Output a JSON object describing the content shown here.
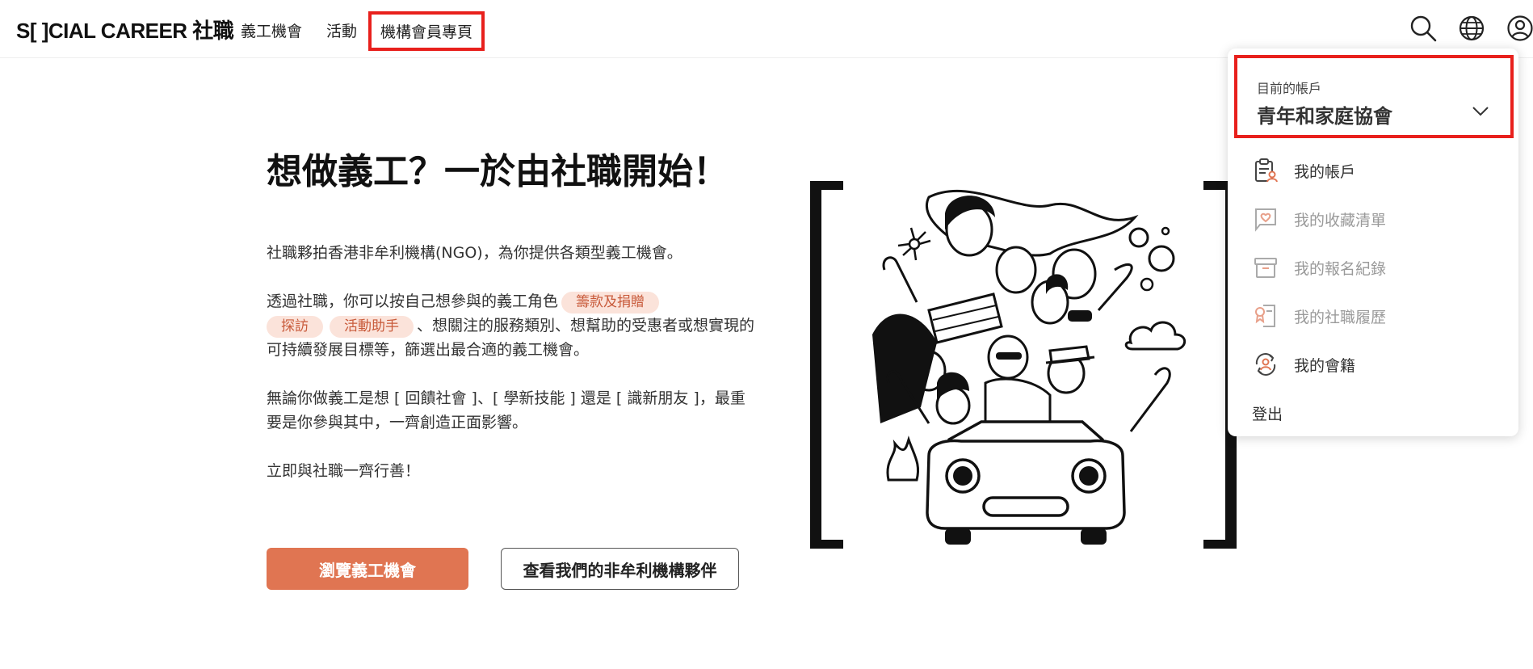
{
  "header": {
    "logo": "S[ ]CIAL CAREER 社職",
    "nav": [
      "義工機會",
      "活動",
      "機構會員專頁"
    ],
    "icons": [
      "search-icon",
      "globe-icon",
      "user-icon"
    ]
  },
  "hero": {
    "title": "想做義工？一於由社職開始！",
    "p1": "社職夥拍香港非牟利機構(NGO)，為你提供各類型義工機會。",
    "p2_before": "透過社職，你可以按自己想參與的義工角色",
    "tags": [
      "籌款及捐贈",
      "探訪",
      "活動助手"
    ],
    "p2_after": "、想關注的服務類別、想幫助的受惠者或想實現的可持續發展目標等，篩選出最合適的義工機會。",
    "p3": "無論你做義工是想 [ 回饋社會 ]、[ 學新技能 ] 還是 [ 識新朋友 ]，最重要是你參與其中，一齊創造正面影響。",
    "p4": "立即與社職一齊行善！",
    "btn_primary": "瀏覽義工機會",
    "btn_secondary": "查看我們的非牟利機構夥伴"
  },
  "dropdown": {
    "current_label": "目前的帳戶",
    "current_name": "青年和家庭協會",
    "items": [
      {
        "label": "我的帳戶",
        "icon": "clipboard-user-icon",
        "active": true
      },
      {
        "label": "我的收藏清單",
        "icon": "heart-flag-icon",
        "active": false
      },
      {
        "label": "我的報名紀錄",
        "icon": "archive-box-icon",
        "active": false
      },
      {
        "label": "我的社職履歷",
        "icon": "certificate-icon",
        "active": false
      },
      {
        "label": "我的會籍",
        "icon": "membership-cycle-icon",
        "active": true
      }
    ],
    "logout": "登出"
  },
  "colors": {
    "accent": "#e07552",
    "tag_bg": "#fbe3da",
    "tag_text": "#c85a3a",
    "highlight_box": "#e8201c"
  }
}
